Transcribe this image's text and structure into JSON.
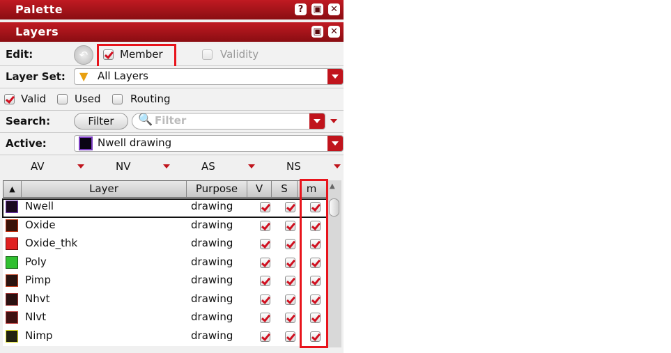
{
  "palette": {
    "title": "Palette",
    "buttons": [
      "?",
      "▣",
      "✕"
    ]
  },
  "layers_panel": {
    "title": "Layers",
    "buttons": [
      "▣",
      "✕"
    ]
  },
  "edit": {
    "label": "Edit:",
    "member_label": "Member",
    "member_checked": true,
    "validity_label": "Validity",
    "validity_checked": false
  },
  "layer_set": {
    "label": "Layer Set:",
    "value": "All Layers"
  },
  "filters": {
    "valid": "Valid",
    "valid_checked": true,
    "used": "Used",
    "used_checked": false,
    "routing": "Routing",
    "routing_checked": false
  },
  "search": {
    "label": "Search:",
    "filter_button": "Filter",
    "placeholder": "Filter"
  },
  "active": {
    "label": "Active:",
    "value": "Nwell drawing"
  },
  "visibility_menus": [
    "AV",
    "NV",
    "AS",
    "NS"
  ],
  "table": {
    "columns": [
      "Layer",
      "Purpose",
      "V",
      "S",
      "m"
    ],
    "rows": [
      {
        "layer": "Nwell",
        "purpose": "drawing",
        "swatch": "#1a0820",
        "swatch_border": "#7a3cc0",
        "v": true,
        "s": true,
        "m": true
      },
      {
        "layer": "Oxide",
        "purpose": "drawing",
        "swatch": "#3a1208",
        "swatch_border": "#c03010",
        "v": true,
        "s": true,
        "m": true
      },
      {
        "layer": "Oxide_thk",
        "purpose": "drawing",
        "swatch": "#e02020",
        "swatch_border": "#6a0a0a",
        "v": true,
        "s": true,
        "m": true
      },
      {
        "layer": "Poly",
        "purpose": "drawing",
        "swatch": "#30c030",
        "swatch_border": "#106010",
        "v": true,
        "s": true,
        "m": true
      },
      {
        "layer": "Pimp",
        "purpose": "drawing",
        "swatch": "#2a1410",
        "swatch_border": "#c04020",
        "v": true,
        "s": true,
        "m": true
      },
      {
        "layer": "Nhvt",
        "purpose": "drawing",
        "swatch": "#2a1010",
        "swatch_border": "#a03030",
        "v": true,
        "s": true,
        "m": true
      },
      {
        "layer": "Nlvt",
        "purpose": "drawing",
        "swatch": "#401010",
        "swatch_border": "#c04040",
        "v": true,
        "s": true,
        "m": true
      },
      {
        "layer": "Nimp",
        "purpose": "drawing",
        "swatch": "#202010",
        "swatch_border": "#e0e020",
        "v": true,
        "s": true,
        "m": true
      }
    ]
  },
  "colors": {
    "titlebar": "#b0151c",
    "accent": "#c0141c",
    "highlight": "#e8141c"
  }
}
